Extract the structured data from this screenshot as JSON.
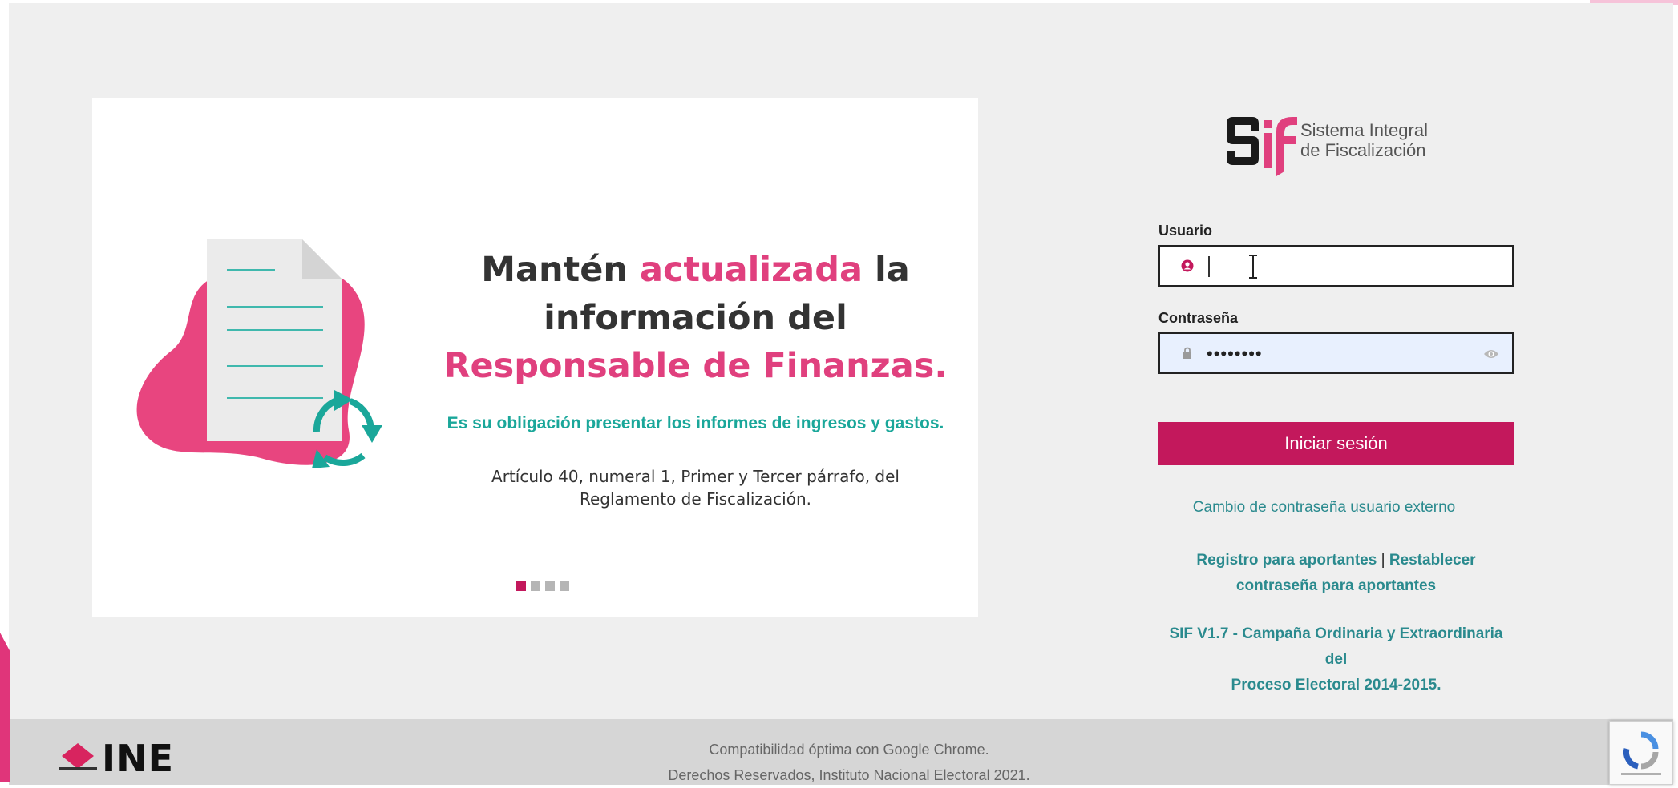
{
  "slide": {
    "headline_1a": "Mantén ",
    "headline_1b": "actualizada",
    "headline_1c": " la",
    "headline_2": "información del",
    "headline_3": "Responsable de Finanzas.",
    "subline": "Es su obligación presentar los informes de ingresos y gastos.",
    "article_1": "Artículo 40, numeral 1, Primer y Tercer párrafo, del",
    "article_2": "Reglamento de Fiscalización.",
    "indicator_count": 4,
    "active_index": 0
  },
  "logo": {
    "line1": "Sistema Integral",
    "line2": "de Fiscalización"
  },
  "login": {
    "user_label": "Usuario",
    "user_value": "",
    "password_label": "Contraseña",
    "password_value": "••••••••",
    "submit_label": "Iniciar sesión"
  },
  "links": {
    "external_password": "Cambio de contraseña usuario externo",
    "register": "Registro para aportantes",
    "separator": " | ",
    "reset_1": "Restablecer",
    "reset_2": "contraseña para aportantes"
  },
  "version": {
    "line1": "SIF V1.7 - Campaña Ordinaria y Extraordinaria del",
    "line2": "Proceso Electoral 2014-2015."
  },
  "footer": {
    "compat": "Compatibilidad óptima con Google Chrome.",
    "rights": "Derechos Reservados, Instituto Nacional Electoral 2021.",
    "ine_text": "INE"
  },
  "colors": {
    "brand": "#c3185c",
    "accent_pink": "#e0407e",
    "teal": "#1aa79a",
    "link": "#2a8a8e"
  }
}
